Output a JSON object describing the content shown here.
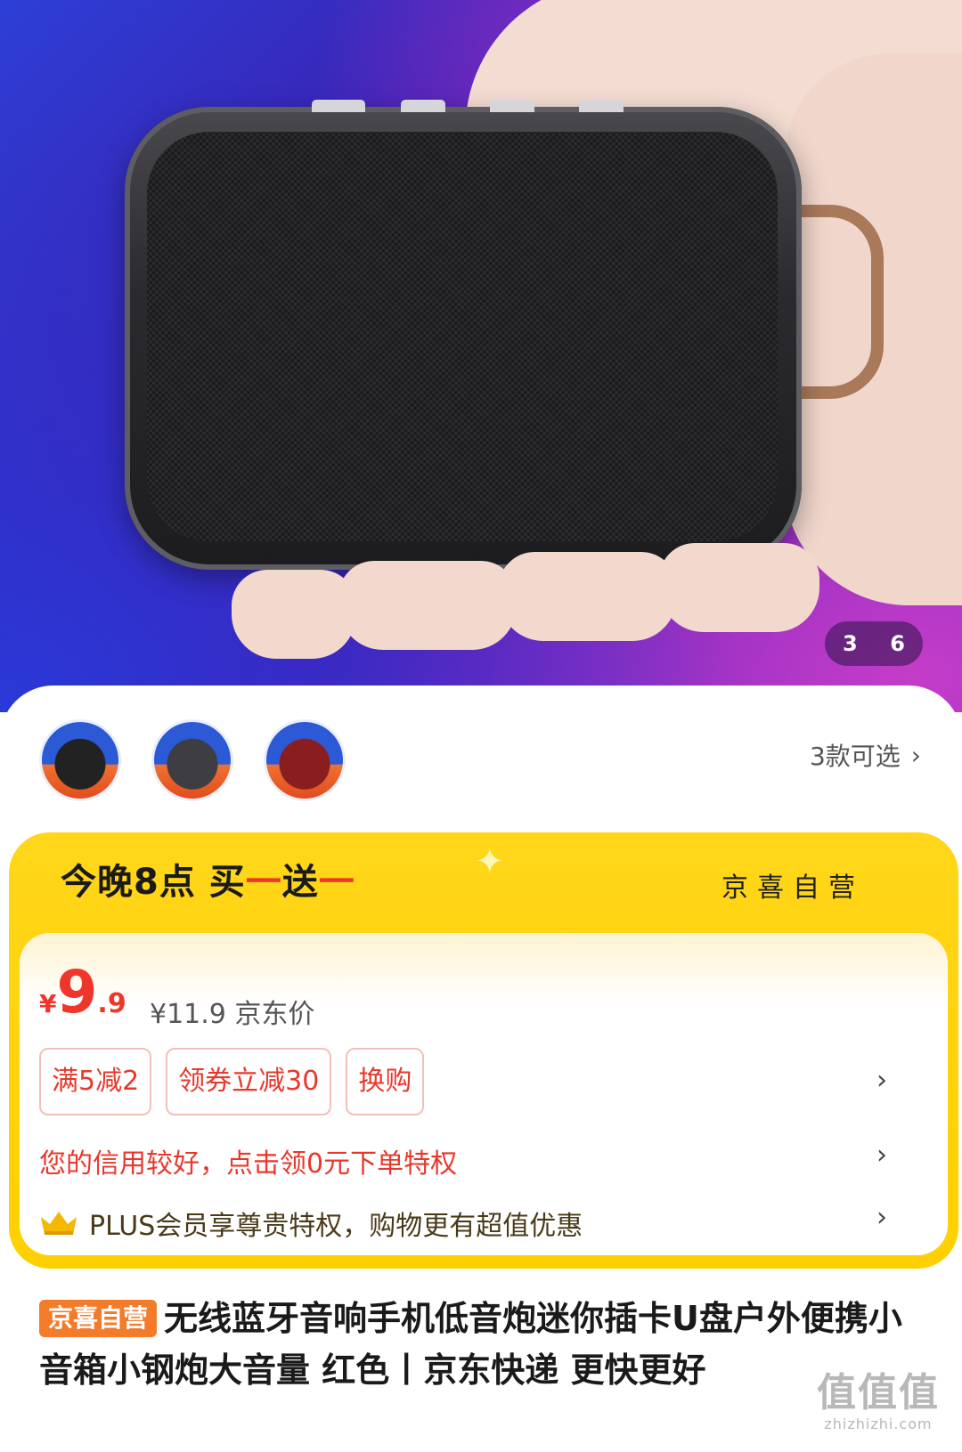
{
  "gallery": {
    "current": "3",
    "total": "6"
  },
  "variants": {
    "thumbnails": [
      "black-variant",
      "gray-variant",
      "red-variant"
    ],
    "label": "3款可选"
  },
  "promo": {
    "title_part1": "今晚8点 买",
    "title_red1": "一",
    "title_part2": "送",
    "title_red2": "一",
    "shop_label": "京喜自营",
    "price_symbol": "¥",
    "price_integer": "9",
    "price_decimal": ".9",
    "original_price": "¥11.9 京东价",
    "coupons": [
      "满5减2",
      "领券立减30",
      "换购"
    ],
    "credit_text": "您的信用较好，点击领0元下单特权",
    "plus_text": "PLUS会员享尊贵特权，购物更有超值优惠",
    "colors": {
      "accent_red": "#f0362a",
      "promo_yellow": "#ffd000"
    }
  },
  "product": {
    "badge": "京喜自营",
    "title": "无线蓝牙音响手机低音炮迷你插卡U盘户外便携小音箱小钢炮大音量 红色丨京东快递 更快更好"
  },
  "watermark": {
    "big": "值值值",
    "small": "zhizhizhi.com"
  }
}
